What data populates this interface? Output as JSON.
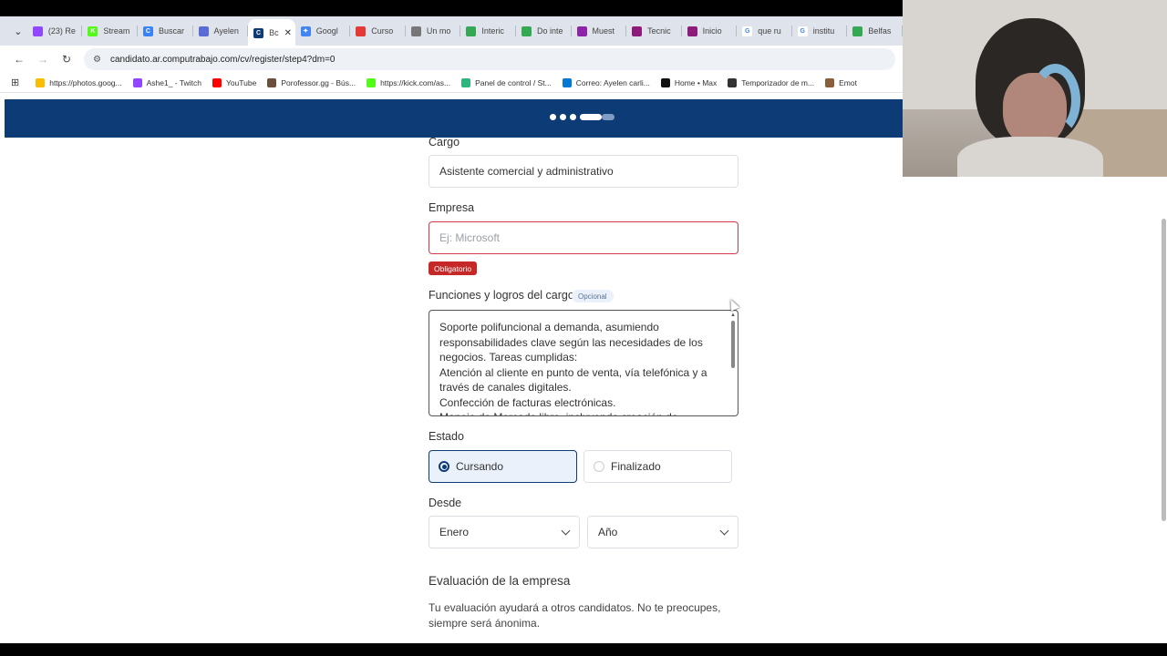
{
  "browser": {
    "tabs": [
      {
        "label": "(23) Re",
        "icon_color": "#9146ff",
        "icon_glyph": ""
      },
      {
        "label": "Stream",
        "icon_color": "#53fc18",
        "icon_glyph": "K"
      },
      {
        "label": "Buscar",
        "icon_color": "#3b82f6",
        "icon_glyph": "C"
      },
      {
        "label": "Ayelen",
        "icon_color": "#5b6bd6",
        "icon_glyph": ""
      },
      {
        "label": "Bc",
        "icon_color": "#0d3b76",
        "icon_glyph": "C",
        "active": true
      },
      {
        "label": "Googl",
        "icon_color": "#4285f4",
        "icon_glyph": "✦"
      },
      {
        "label": "Curso",
        "icon_color": "#e53935",
        "icon_glyph": ""
      },
      {
        "label": "Un mo",
        "icon_color": "#777777",
        "icon_glyph": ""
      },
      {
        "label": "Interic",
        "icon_color": "#34a853",
        "icon_glyph": ""
      },
      {
        "label": "Do inte",
        "icon_color": "#34a853",
        "icon_glyph": ""
      },
      {
        "label": "Muest",
        "icon_color": "#8e24aa",
        "icon_glyph": ""
      },
      {
        "label": "Tecnic",
        "icon_color": "#8e1b7a",
        "icon_glyph": ""
      },
      {
        "label": "Inicio",
        "icon_color": "#8e1b7a",
        "icon_glyph": ""
      },
      {
        "label": "que ru",
        "icon_color": "#ffffff",
        "icon_glyph": "G"
      },
      {
        "label": "institu",
        "icon_color": "#ffffff",
        "icon_glyph": "G"
      },
      {
        "label": "Belfas",
        "icon_color": "#34a853",
        "icon_glyph": ""
      }
    ],
    "tab_close": "✕",
    "tab_dropdown": "⌄",
    "url": "candidato.ar.computrabajo.com/cv/register/step4?dm=0",
    "bookmarks": [
      {
        "label": "https://photos.goog...",
        "icon_color": "#fbbc04"
      },
      {
        "label": "Ashe1_ - Twitch",
        "icon_color": "#9146ff"
      },
      {
        "label": "YouTube",
        "icon_color": "#ff0000"
      },
      {
        "label": "Porofessor.gg - Bús...",
        "icon_color": "#6b4f3a"
      },
      {
        "label": "https://kick.com/as...",
        "icon_color": "#53fc18"
      },
      {
        "label": "Panel de control / St...",
        "icon_color": "#2eb67d"
      },
      {
        "label": "Correo: Ayelen carli...",
        "icon_color": "#0078d4"
      },
      {
        "label": "Home • Max",
        "icon_color": "#111111"
      },
      {
        "label": "Temporizador de m...",
        "icon_color": "#333333"
      },
      {
        "label": "Emot",
        "icon_color": "#8b5e3c"
      }
    ]
  },
  "form": {
    "cargo": {
      "label": "Cargo",
      "value": "Asistente comercial y administrativo"
    },
    "empresa": {
      "label": "Empresa",
      "placeholder": "Ej: Microsoft",
      "error": "Obligatorio"
    },
    "funciones": {
      "label": "Funciones y logros del cargo",
      "badge": "Opcional",
      "lines": [
        "Soporte polifuncional a demanda, asumiendo",
        "responsabilidades clave según las necesidades de los",
        "negocios. Tareas cumplidas:",
        "Atención al cliente en punto de venta, vía telefónica y a",
        "través de canales digitales.",
        "Confección de facturas electrónicas.",
        "Manejo de Mercado libre, incluyendo creación de"
      ]
    },
    "estado": {
      "label": "Estado",
      "options": [
        {
          "label": "Cursando",
          "selected": true
        },
        {
          "label": "Finalizado",
          "selected": false
        }
      ]
    },
    "desde": {
      "label": "Desde",
      "month": "Enero",
      "year": "Año"
    },
    "evaluacion": {
      "title": "Evaluación de la empresa",
      "description": "Tu evaluación ayudará a otros candidatos. No te preocupes, siempre será ánonima."
    }
  },
  "colors": {
    "brand": "#0d3b76",
    "error": "#c62828",
    "selected_bg": "#eaf1fa"
  }
}
